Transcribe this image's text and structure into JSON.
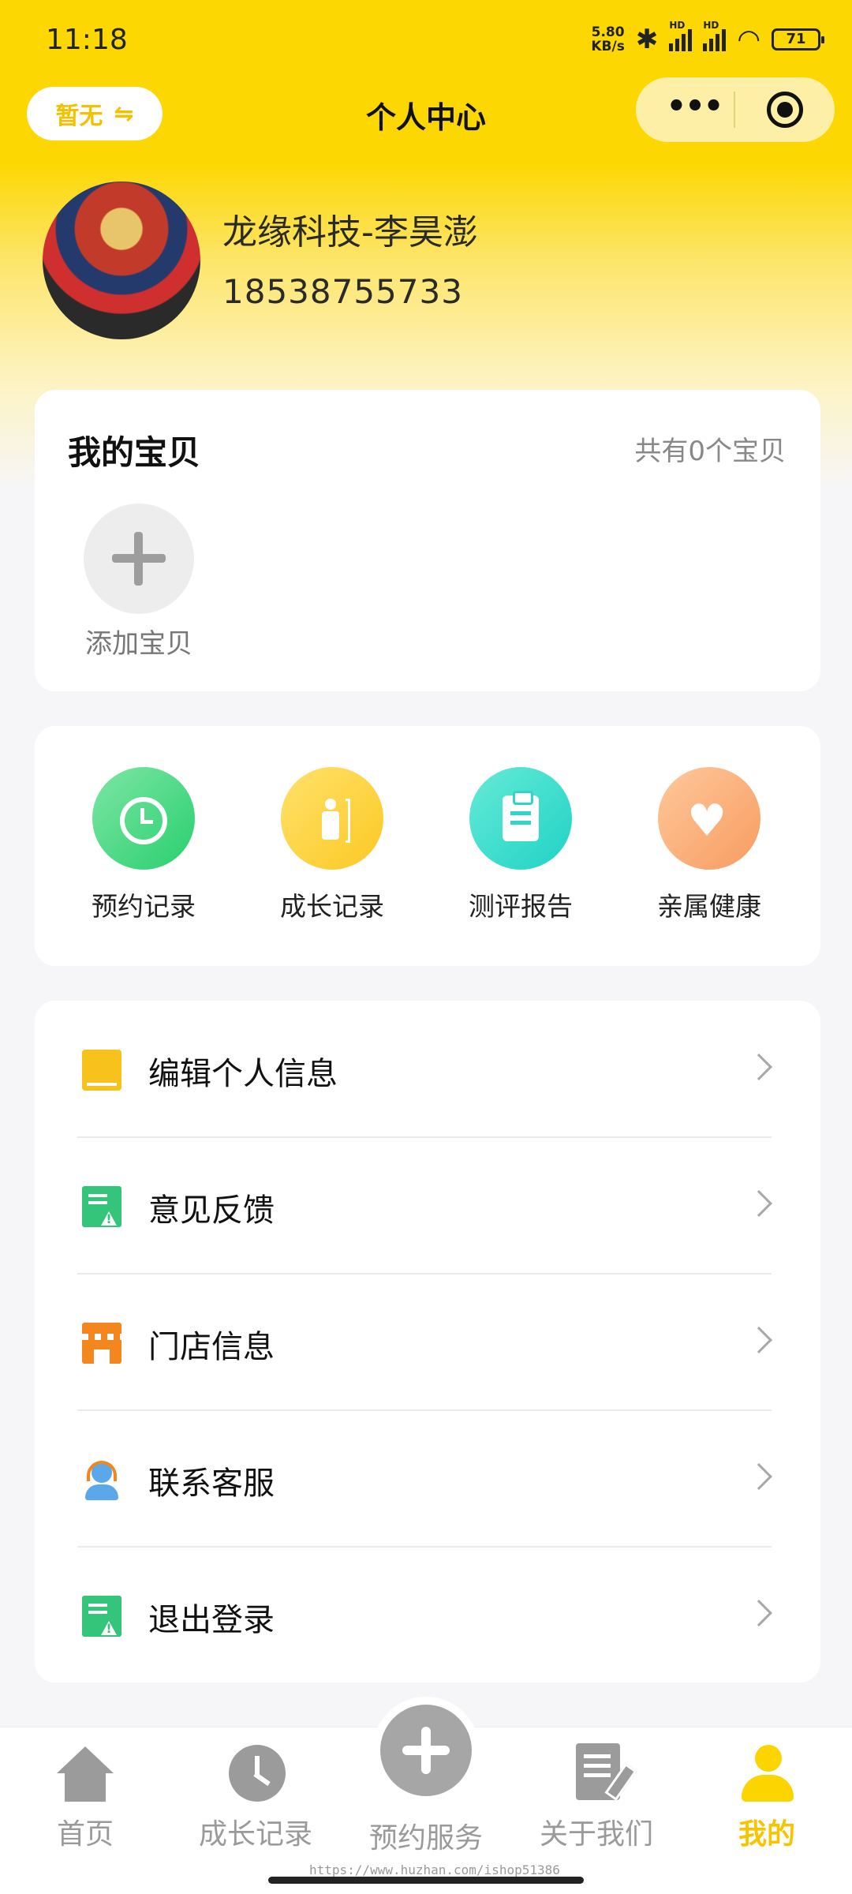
{
  "status_bar": {
    "time": "11:18",
    "net_speed_value": "5.80",
    "net_speed_unit": "KB/s",
    "bluetooth_icon": "bluetooth-icon",
    "signal_1_label": "HD",
    "signal_2_label": "HD",
    "wifi_icon": "wifi-icon",
    "battery": "71"
  },
  "nav": {
    "left_pill_label": "暂无",
    "left_pill_icon": "⇋",
    "title": "个人中心",
    "more_icon": "•••"
  },
  "profile": {
    "name": "龙缘科技-李昊澎",
    "phone": "18538755733"
  },
  "babies": {
    "title": "我的宝贝",
    "count_text": "共有0个宝贝",
    "add_label": "添加宝贝"
  },
  "shortcuts": [
    {
      "label": "预约记录",
      "icon": "alarm-clock-icon",
      "color": "#29cf6e"
    },
    {
      "label": "成长记录",
      "icon": "growth-height-icon",
      "color": "#fcc924"
    },
    {
      "label": "测评报告",
      "icon": "clipboard-icon",
      "color": "#1fd3c6"
    },
    {
      "label": "亲属健康",
      "icon": "heart-pulse-icon",
      "color": "#f79c60"
    }
  ],
  "shortcut_heart_glyph": "♥",
  "menu": [
    {
      "label": "编辑个人信息",
      "icon": "book-icon"
    },
    {
      "label": "意见反馈",
      "icon": "feedback-doc-icon"
    },
    {
      "label": "门店信息",
      "icon": "store-icon"
    },
    {
      "label": "联系客服",
      "icon": "customer-service-icon"
    },
    {
      "label": "退出登录",
      "icon": "logout-doc-icon"
    }
  ],
  "tabbar": {
    "home": "首页",
    "growth": "成长记录",
    "booking": "预约服务",
    "about": "关于我们",
    "mine": "我的",
    "active_color": "#f7c500"
  },
  "watermark": "https://www.huzhan.com/ishop51386",
  "colors": {
    "brand_yellow": "#fcd701",
    "background": "#f6f6f8"
  }
}
